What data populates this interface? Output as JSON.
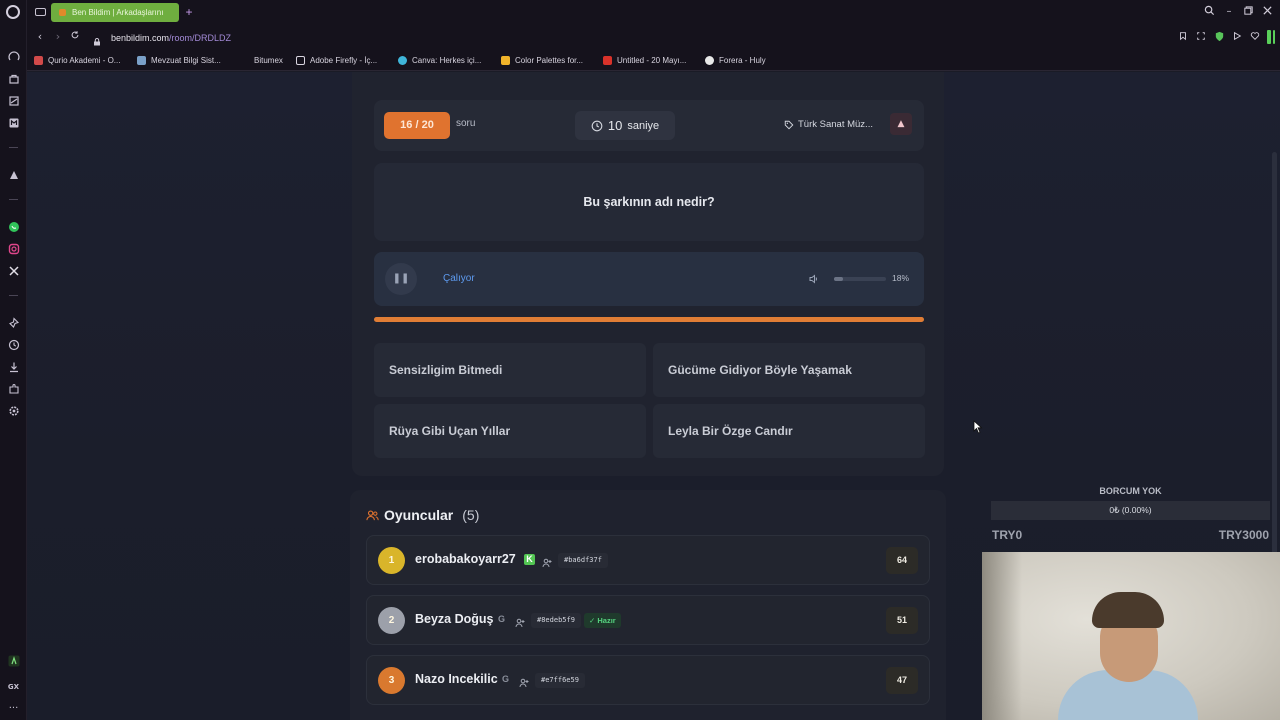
{
  "browser": {
    "tab_title": "Ben Bildim | Arkadaşlarını",
    "url_host": "benbildim.com",
    "url_path": "/room/DRDLDZ",
    "bookmarks": [
      "Qurio Akademi - O...",
      "Mevzuat Bilgi Sist...",
      "Bitumex",
      "Adobe Firefly - İç...",
      "Canva: Herkes içi...",
      "Color Palettes for...",
      "Untitled - 20 Mayı...",
      "Forera - Huly"
    ],
    "sidebar_bottom_label": "GX"
  },
  "quiz": {
    "question_counter": "16 / 20",
    "question_counter_label": "soru",
    "timer_value": "10",
    "timer_unit": "saniye",
    "category": "Türk Sanat Müz...",
    "question": "Bu şarkının adı nedir?",
    "player_status": "Çalıyor",
    "volume_percent": "18%",
    "volume_level": 0.18,
    "progress": 1.0,
    "answers": [
      "Sensizligim Bitmedi",
      "Gücüme Gidiyor Böyle Yaşamak",
      "Rüya Gibi Uçan Yıllar",
      "Leyla Bir Özge Candır"
    ]
  },
  "players": {
    "title": "Oyuncular",
    "count": "(5)",
    "list": [
      {
        "rank": "1",
        "name": "erobabakoyarr27",
        "id": "#ba6df37f",
        "score": "64",
        "rank_color": "#d9b52a",
        "badge": "K",
        "badge_color": "#53c653",
        "status": ""
      },
      {
        "rank": "2",
        "name": "Beyza Doğuş",
        "id": "#8edeb5f9",
        "score": "51",
        "rank_color": "#9ca0aa",
        "badge": "G",
        "badge_color": "#8a8f9b",
        "status": "Hazır"
      },
      {
        "rank": "3",
        "name": "Nazo Incekilic",
        "id": "#e7ff6e59",
        "score": "47",
        "rank_color": "#d9792f",
        "badge": "G",
        "badge_color": "#8a8f9b",
        "status": ""
      }
    ]
  },
  "overlay": {
    "label": "BORCUM YOK",
    "bar_text": "0₺ (0.00%)",
    "min": "TRY0",
    "max": "TRY3000"
  },
  "colors": {
    "accent_orange": "#e0732f",
    "playing_blue": "#5e9bf0",
    "ready_green": "#55d27f"
  }
}
